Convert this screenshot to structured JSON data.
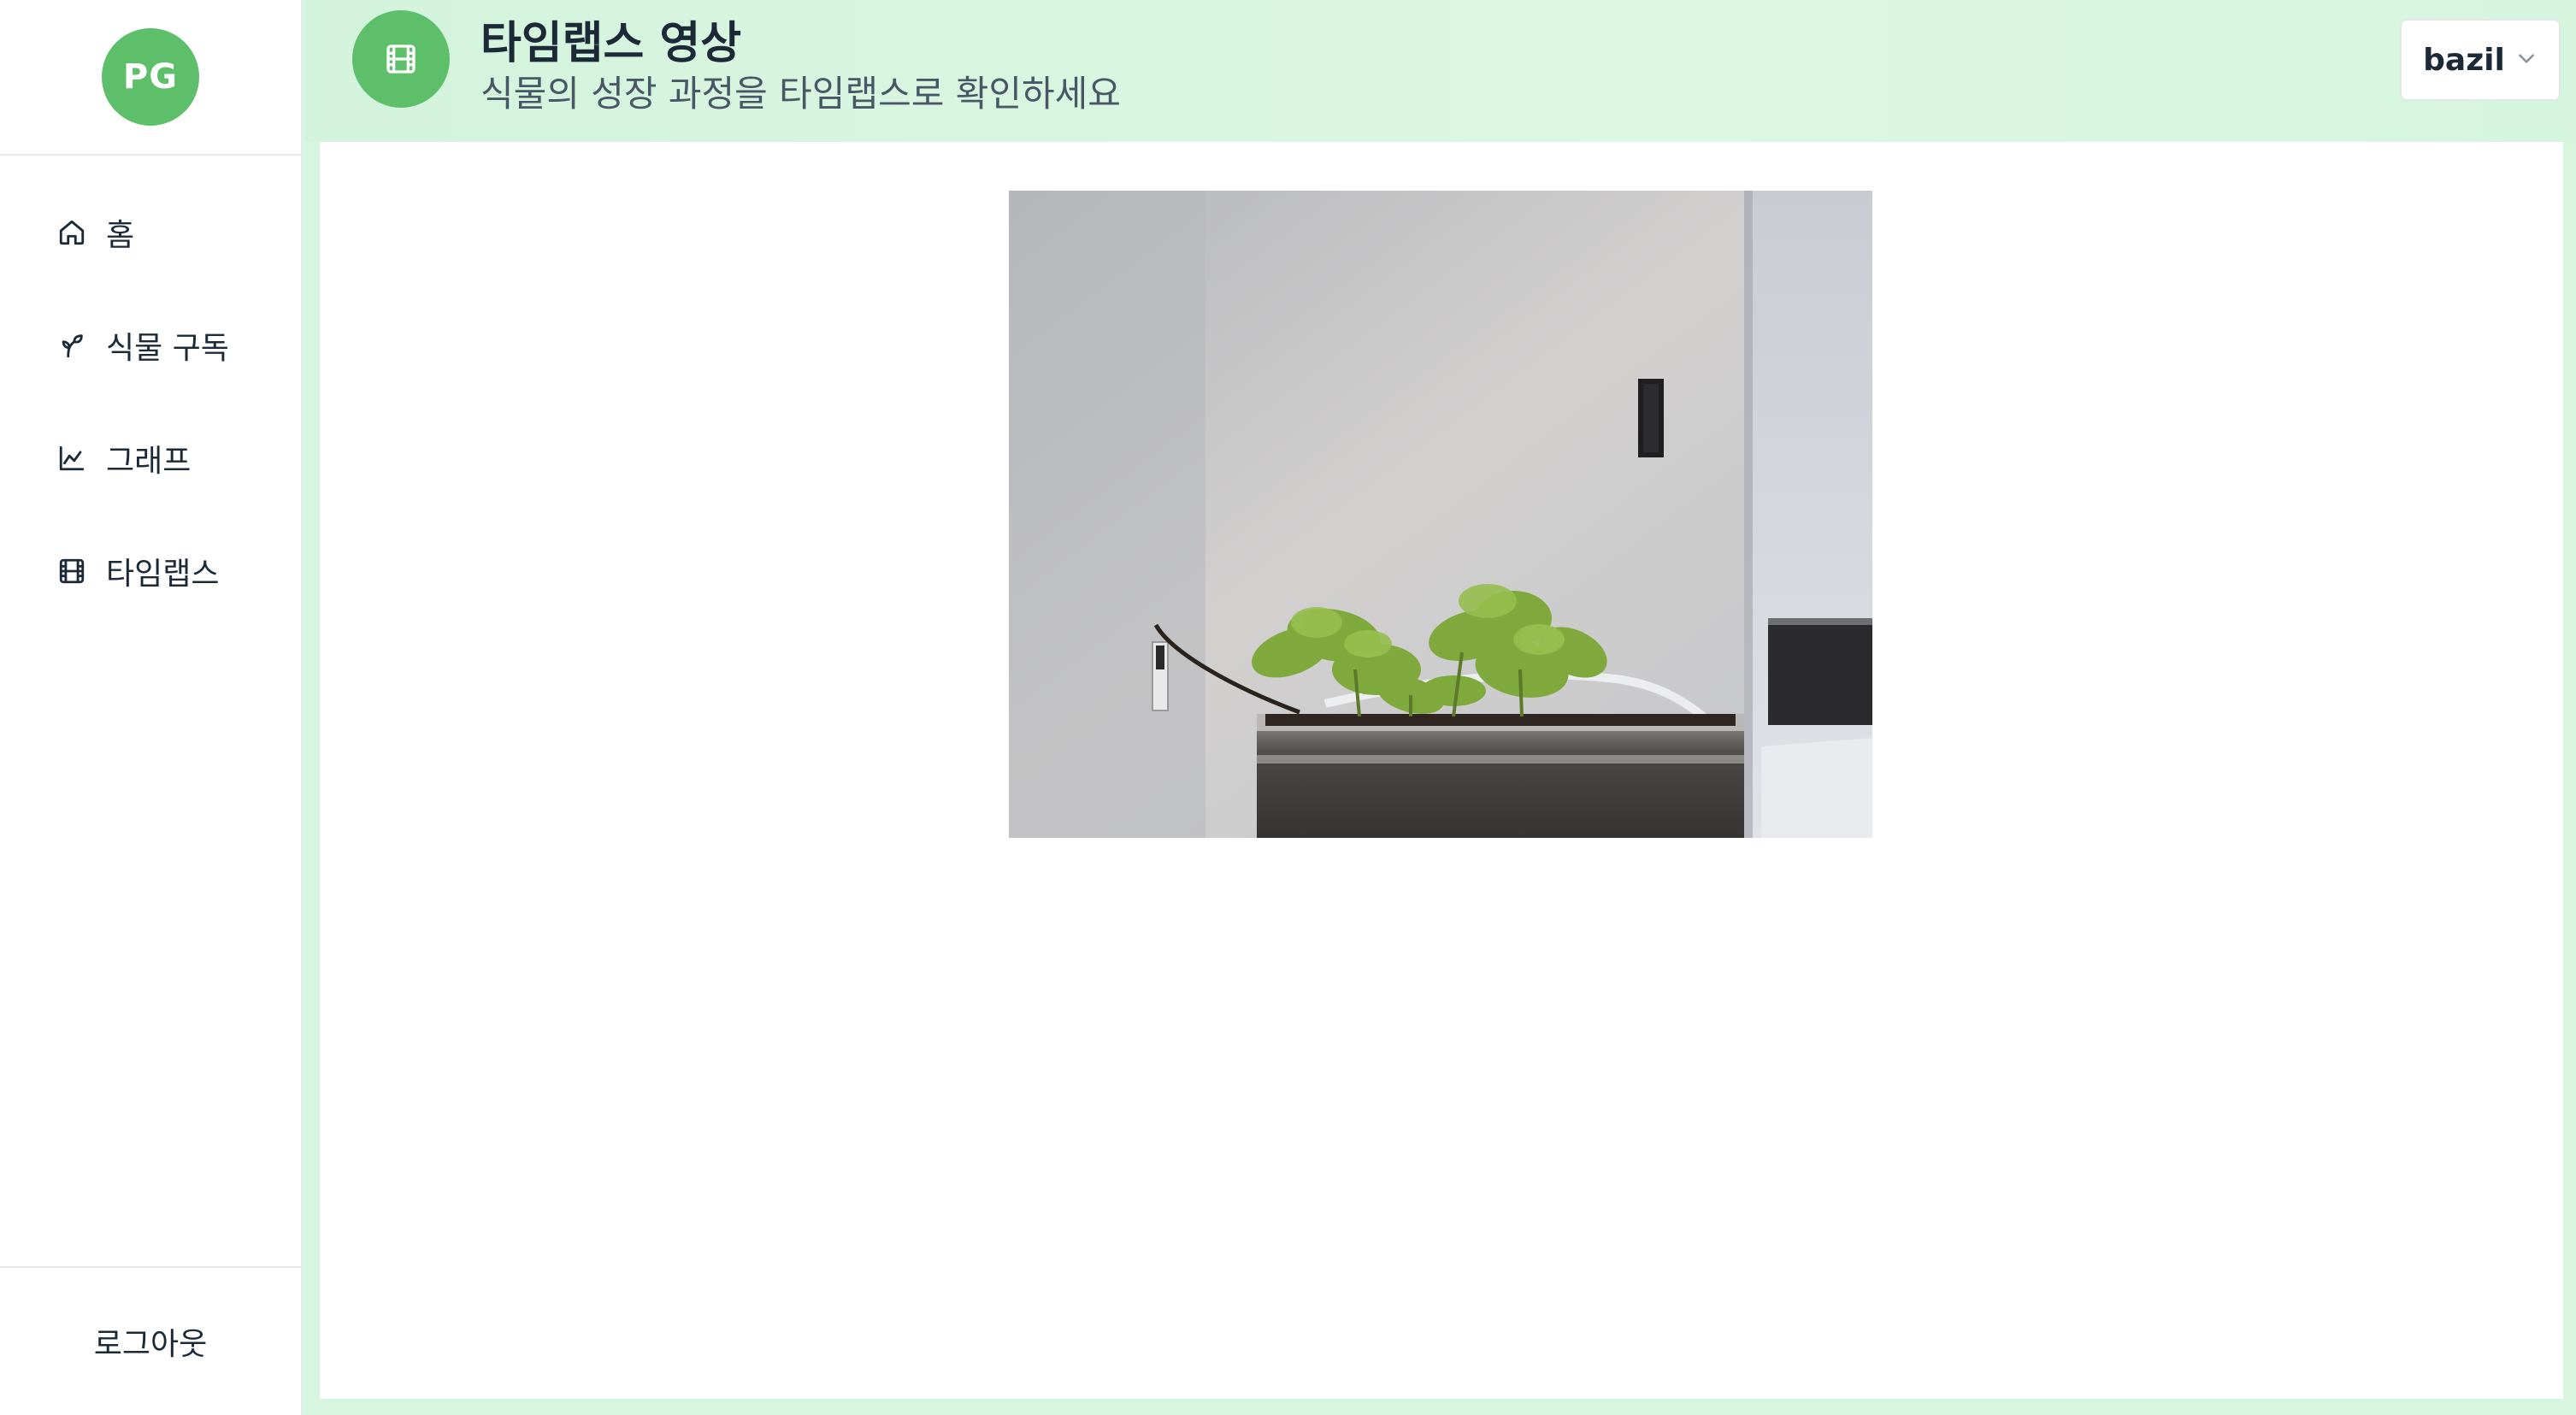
{
  "sidebar": {
    "avatar_initials": "PG",
    "nav": [
      {
        "label": "홈",
        "icon": "home-icon"
      },
      {
        "label": "식물 구독",
        "icon": "sprout-icon"
      },
      {
        "label": "그래프",
        "icon": "chart-icon"
      },
      {
        "label": "타임랩스",
        "icon": "film-icon"
      }
    ],
    "logout_label": "로그아웃"
  },
  "header": {
    "icon": "film-icon",
    "title": "타임랩스 영상",
    "subtitle": "식물의 성장 과정을 타임랩스로 확인하세요",
    "plant_select": {
      "value": "bazil",
      "icon": "chevron-down-icon"
    }
  },
  "theme": {
    "accent": "#5dbf6a",
    "header_bg": "#d8f5e0",
    "text": "#1c2a38"
  },
  "main": {
    "video": {
      "content": "webcam-frame-basil-plant"
    }
  }
}
